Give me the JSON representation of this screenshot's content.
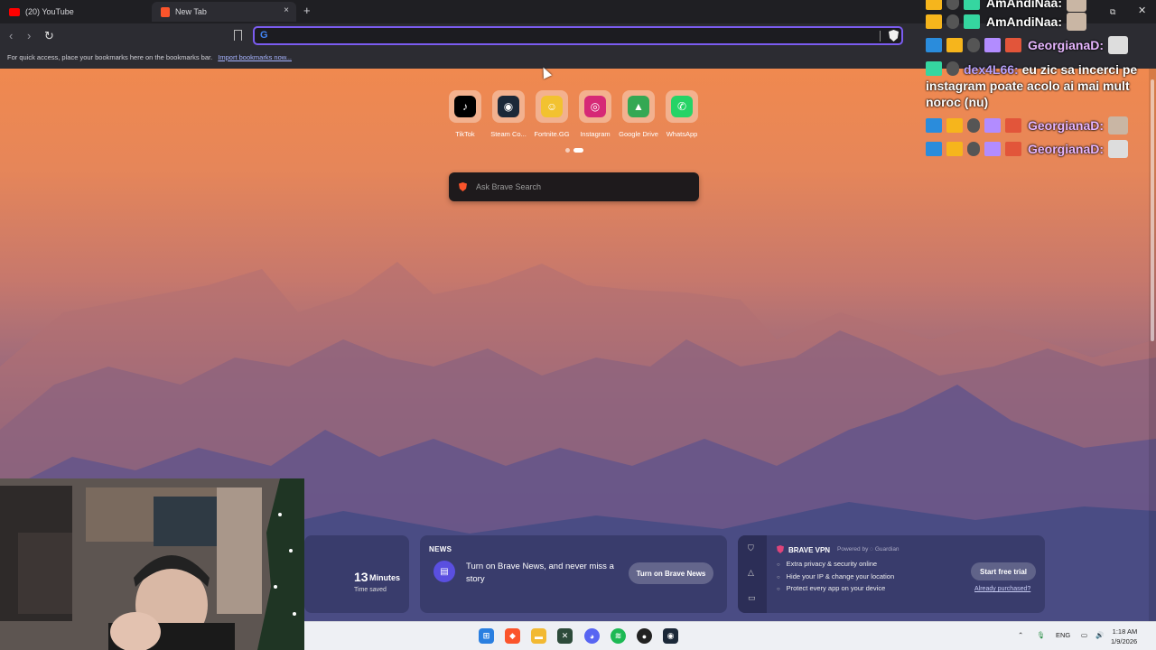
{
  "browser": {
    "tabs": [
      {
        "label": "(20) YouTube",
        "favicon_color": "#ff0000"
      },
      {
        "label": "New Tab",
        "favicon_color": "#fb542b"
      }
    ],
    "tab_close_glyph": "×",
    "new_tab_glyph": "+",
    "url_value": "",
    "bookmarks_bar": {
      "text": "For quick access, place your bookmarks here on the bookmarks bar.",
      "link": "Import bookmarks now..."
    }
  },
  "new_tab_page": {
    "top_sites": [
      {
        "label": "TikTok",
        "icon": "tiktok-icon",
        "color": "#000000",
        "glyph": "♪"
      },
      {
        "label": "Steam Co...",
        "icon": "steam-icon",
        "color": "#1b2838",
        "glyph": "◉"
      },
      {
        "label": "Fortnite.GG",
        "icon": "fortnite-gg-icon",
        "color": "#f2c230",
        "glyph": "☺"
      },
      {
        "label": "Instagram",
        "icon": "instagram-icon",
        "color": "#d62976",
        "glyph": "◎"
      },
      {
        "label": "Google Drive",
        "icon": "google-drive-icon",
        "color": "#34a853",
        "glyph": "▲"
      },
      {
        "label": "WhatsApp",
        "icon": "whatsapp-icon",
        "color": "#25d366",
        "glyph": "✆"
      }
    ],
    "search_placeholder": "Ask Brave Search",
    "stats": {
      "value": "13",
      "unit": "Minutes",
      "label": "Time saved"
    },
    "news": {
      "header": "NEWS",
      "message": "Turn on Brave News, and never miss a story",
      "button": "Turn on Brave News"
    },
    "vpn": {
      "title": "BRAVE VPN",
      "powered_by": "Powered by",
      "powered_name": "Guardian",
      "features": [
        "Extra privacy & security online",
        "Hide your IP & change your location",
        "Protect every app on your device"
      ],
      "cta": "Start free trial",
      "link": "Already purchased?"
    }
  },
  "chat": {
    "rows": [
      {
        "user": "AmAndiNaa:",
        "color": "#ffffff"
      },
      {
        "user": "AmAndiNaa:",
        "color": "#ffffff"
      },
      {
        "user": "GeorgianaD:",
        "color": "#e7b6ff"
      }
    ],
    "message_user": "dex4L66:",
    "message_user_color": "#b9a3ff",
    "message_text": "eu zic sa incerci pe instagram poate acolo ai mai mult noroc (nu)",
    "bottom_rows": [
      {
        "user": "GeorgianaD:",
        "color": "#e7b6ff"
      },
      {
        "user": "GeorgianaD:",
        "color": "#e7b6ff"
      }
    ]
  },
  "taskbar": {
    "language": "ENG",
    "time": "1:18 AM",
    "date": "1/9/2026"
  },
  "colors": {
    "accent": "#7b5cf0",
    "brave_orange": "#fb542b"
  }
}
